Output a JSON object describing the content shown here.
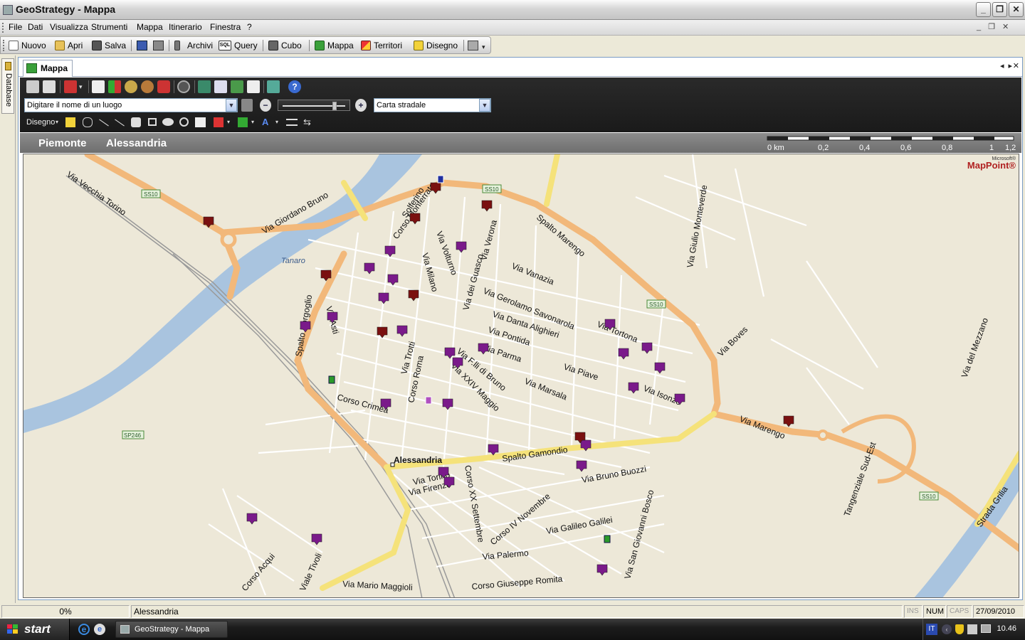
{
  "window": {
    "title": "GeoStrategy - Mappa",
    "controls": [
      "_",
      "❐",
      "✕"
    ]
  },
  "menu": {
    "items": [
      "File",
      "Dati",
      "Visualizza",
      "Strumenti",
      "Mappa",
      "Itinerario",
      "Finestra",
      "?"
    ]
  },
  "toolbar": {
    "new": "Nuovo",
    "open": "Apri",
    "save": "Salva",
    "archive": "Archivi",
    "query": "Query",
    "cube": "Cubo",
    "map": "Mappa",
    "territories": "Territori",
    "drawing": "Disegno"
  },
  "sidebar": {
    "tab_label": "Database"
  },
  "doc": {
    "tab_label": "Mappa"
  },
  "maptools": {
    "search_placeholder": "Digitare il nome di un luogo",
    "map_style": "Carta stradale",
    "zoom_level": 0.85,
    "draw_label": "Disegno"
  },
  "breadcrumb": {
    "region": "Piemonte",
    "city": "Alessandria"
  },
  "scale": {
    "labels": [
      "0 km",
      "0,2",
      "0,4",
      "0,6",
      "0,8",
      "1",
      "1,2"
    ]
  },
  "map": {
    "brand_top": "Microsoft®",
    "brand": "MapPoint®",
    "river_label": "Tanaro",
    "city_label": "Alessandria",
    "road_shields": [
      "SS10",
      "SS10",
      "SS10",
      "SS10",
      "SS10",
      "SP246"
    ],
    "street_labels": [
      "Via Vecchia Torino",
      "Via Giordano Bruno",
      "Solferino",
      "Corso Monferrato",
      "Via Verona",
      "Via Volturno",
      "Via Milano",
      "Via dei Guasco",
      "Via Vanazia",
      "Spalto Marengo",
      "Via Giulio Monteverde",
      "Via Gerolamo Savonarola",
      "Via Danta Alighieri",
      "Via Pontida",
      "Via Parma",
      "Spalto Borgoglio",
      "Via Asti",
      "Via Trotti",
      "Corso Roma",
      "Via F.lli di Bruno",
      "Via XXIV Maggio",
      "Corso Crimea",
      "Via Piave",
      "Via Marsala",
      "Via Tortona",
      "Via Isonzo",
      "Via Boves",
      "Via del Mezzano",
      "Via Marengo",
      "Tangenziale Sud-Est",
      "Strada Grilia",
      "Spalto Gamondio",
      "Corso XX Settembre",
      "Via Torino",
      "Via Firenze",
      "Via Bruno Buozzi",
      "Corso IV Novembre",
      "Via Galileo Galilei",
      "Via San Giovanni Bosco",
      "Via Palermo",
      "Via Mario Maggioli",
      "Corso Giuseppe Romita",
      "Corso Acqui",
      "Viale Tivoli"
    ],
    "marker_legend": {
      "purple": "#7a1a8a",
      "dark_red": "#7a1010",
      "green_pin": "#2a9a2a",
      "blue_pin": "#2030a0"
    }
  },
  "status": {
    "progress": "0%",
    "location": "Alessandria",
    "ins": "INS",
    "num": "NUM",
    "caps": "CAPS",
    "date": "27/09/2010"
  },
  "taskbar": {
    "start": "start",
    "task": "GeoStrategy - Mappa",
    "lang": "IT",
    "time": "10.46"
  },
  "colors": {
    "road_major": "#f2b87a",
    "road_minor": "#ffffff",
    "water": "#a9c4df",
    "land": "#ede8d8",
    "highway_yellow": "#f5e27a"
  }
}
